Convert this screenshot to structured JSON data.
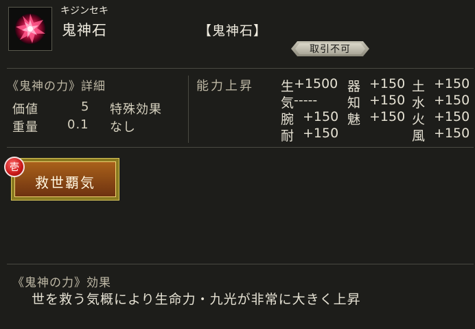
{
  "item": {
    "furigana": "キジンセキ",
    "name": "鬼神石",
    "bracket_name": "【鬼神石】",
    "trade_badge": "取引不可",
    "icon": "crimson-gem-icon"
  },
  "details": {
    "heading": "《鬼神の力》詳細",
    "rows": [
      {
        "label": "価値",
        "value": "5"
      },
      {
        "label": "重量",
        "value": "0.1"
      }
    ],
    "special_label": "特殊効果",
    "special_value": "なし"
  },
  "ability": {
    "heading": "能力上昇",
    "cells": [
      {
        "label": "生",
        "value": "+1500"
      },
      {
        "label": "器",
        "value": "+150"
      },
      {
        "label": "土",
        "value": "+150"
      },
      {
        "label": "気",
        "value": "-----"
      },
      {
        "label": "知",
        "value": "+150"
      },
      {
        "label": "水",
        "value": "+150"
      },
      {
        "label": "腕",
        "value": "+150"
      },
      {
        "label": "魅",
        "value": "+150"
      },
      {
        "label": "火",
        "value": "+150"
      },
      {
        "label": "耐",
        "value": "+150"
      },
      {
        "label": "風",
        "value": "+150"
      }
    ]
  },
  "skill": {
    "number": "壱",
    "name": "救世覇気"
  },
  "effect": {
    "heading": "《鬼神の力》効果",
    "description": "世を救う気概により生命力・九光が非常に大きく上昇"
  },
  "colors": {
    "background": "#1d1d1a",
    "text": "#e6e2d4",
    "skill_plate": "#8a4a18",
    "skill_badge": "#c81818"
  }
}
